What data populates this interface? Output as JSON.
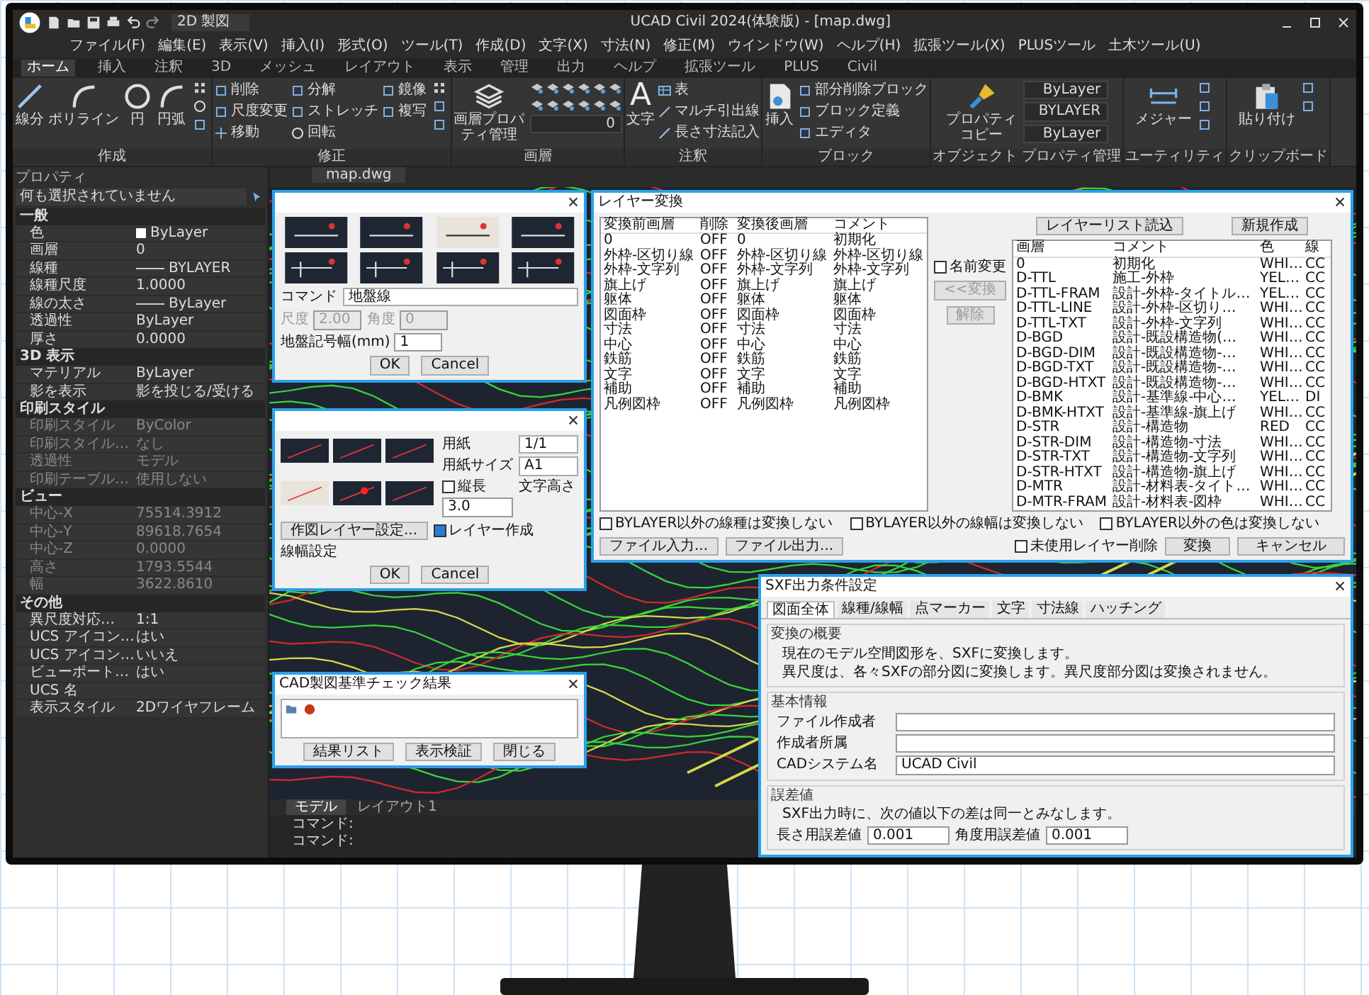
{
  "window": {
    "title": "UCAD Civil 2024(体験版) - [map.dwg]",
    "workspace": "2D 製図"
  },
  "menu": [
    "ファイル(F)",
    "編集(E)",
    "表示(V)",
    "挿入(I)",
    "形式(O)",
    "ツール(T)",
    "作成(D)",
    "文字(X)",
    "寸法(N)",
    "修正(M)",
    "ウインドウ(W)",
    "ヘルプ(H)",
    "拡張ツール(X)",
    "PLUSツール",
    "土木ツール(U)"
  ],
  "ribbon_tabs": [
    {
      "label": "ホーム",
      "selected": true
    },
    {
      "label": "挿入",
      "selected": false
    },
    {
      "label": "注釈",
      "selected": false
    },
    {
      "label": "3D",
      "selected": false
    },
    {
      "label": "メッシュ",
      "selected": false
    },
    {
      "label": "レイアウト",
      "selected": false
    },
    {
      "label": "表示",
      "selected": false
    },
    {
      "label": "管理",
      "selected": false
    },
    {
      "label": "出力",
      "selected": false
    },
    {
      "label": "ヘルプ",
      "selected": false
    },
    {
      "label": "拡張ツール",
      "selected": false
    },
    {
      "label": "PLUS",
      "selected": false
    },
    {
      "label": "Civil",
      "selected": false
    }
  ],
  "ribbon_groups": [
    {
      "title": "作成",
      "large_buttons": [
        {
          "label": "線分",
          "kind": "line"
        },
        {
          "label": "ポリライン",
          "kind": "arc"
        },
        {
          "label": "円",
          "kind": "circle"
        },
        {
          "label": "円弧",
          "kind": "arc"
        }
      ],
      "icon_buttons": [
        {
          "kind": "grid"
        },
        {
          "kind": "circle"
        },
        {
          "kind": "square"
        }
      ]
    },
    {
      "title": "修正",
      "small_buttons": [
        {
          "label": "削除",
          "kind": "square"
        },
        {
          "label": "尺度変更",
          "kind": "square"
        },
        {
          "label": "移動",
          "kind": "move"
        },
        {
          "label": "分解",
          "kind": "square"
        },
        {
          "label": "ストレッチ",
          "kind": "square"
        },
        {
          "label": "回転",
          "kind": "circle"
        },
        {
          "label": "鏡像",
          "kind": "square"
        },
        {
          "label": "複写",
          "kind": "square"
        }
      ],
      "icon_buttons": [
        {
          "kind": "grid"
        },
        {
          "kind": "square"
        },
        {
          "kind": "square"
        }
      ]
    },
    {
      "title": "画層",
      "large_buttons": [
        {
          "label": "画層プロパティ管理",
          "kind": "layers"
        }
      ],
      "icon_buttons": [
        {
          "kind": "layer"
        },
        {
          "kind": "layer"
        },
        {
          "kind": "layer"
        },
        {
          "kind": "layer"
        },
        {
          "kind": "layer"
        },
        {
          "kind": "layer"
        },
        {
          "kind": "layer"
        },
        {
          "kind": "layer"
        },
        {
          "kind": "layer"
        },
        {
          "kind": "layer"
        },
        {
          "kind": "layer"
        },
        {
          "kind": "layer"
        }
      ],
      "dropdowns": [
        {
          "label": "0"
        }
      ]
    },
    {
      "title": "注釈",
      "large_buttons": [
        {
          "label": "文字",
          "kind": "text",
          "glyph": "A"
        }
      ],
      "small_buttons": [
        {
          "label": "表",
          "kind": "table"
        },
        {
          "label": "マルチ引出線",
          "kind": "line"
        },
        {
          "label": "長さ寸法記入",
          "kind": "line"
        }
      ]
    },
    {
      "title": "ブロック",
      "large_buttons": [
        {
          "label": "挿入",
          "kind": "insert"
        }
      ],
      "small_buttons": [
        {
          "label": "部分削除ブロック",
          "kind": "square"
        },
        {
          "label": "ブロック定義",
          "kind": "square"
        },
        {
          "label": "エディタ",
          "kind": "square"
        }
      ]
    },
    {
      "title": "オブジェクト プロパティ管理",
      "large_buttons": [
        {
          "label": "プロパティコピー",
          "kind": "brush"
        }
      ],
      "dropdowns": [
        {
          "label": "ByLayer"
        },
        {
          "label": "BYLAYER"
        },
        {
          "label": "ByLayer"
        }
      ]
    },
    {
      "title": "ユーティリティ",
      "large_buttons": [
        {
          "label": "メジャー",
          "kind": "measure"
        }
      ],
      "icon_buttons": [
        {
          "kind": "square"
        },
        {
          "kind": "square"
        },
        {
          "kind": "square"
        }
      ]
    },
    {
      "title": "クリップボード",
      "large_buttons": [
        {
          "label": "貼り付け",
          "kind": "paste"
        }
      ],
      "icon_buttons": [
        {
          "kind": "square"
        },
        {
          "kind": "square"
        }
      ]
    }
  ],
  "properties": {
    "title": "プロパティ",
    "selection": "何も選択されていません",
    "sections": [
      {
        "title": "一般",
        "rows": [
          {
            "label": "色",
            "value": "ByLayer",
            "kind": "swatch",
            "disabled": false
          },
          {
            "label": "画層",
            "value": "0",
            "kind": "text",
            "disabled": false
          },
          {
            "label": "線種",
            "value": "BYLAYER",
            "kind": "line",
            "disabled": false
          },
          {
            "label": "線種尺度",
            "value": "1.0000",
            "kind": "text",
            "disabled": false
          },
          {
            "label": "線の太さ",
            "value": "ByLayer",
            "kind": "line",
            "disabled": false
          },
          {
            "label": "透過性",
            "value": "ByLayer",
            "kind": "text",
            "disabled": false
          },
          {
            "label": "厚さ",
            "value": "0.0000",
            "kind": "text",
            "disabled": false
          }
        ]
      },
      {
        "title": "3D 表示",
        "rows": [
          {
            "label": "マテリアル",
            "value": "ByLayer",
            "kind": "text",
            "disabled": false
          },
          {
            "label": "影を表示",
            "value": "影を投じる/受ける",
            "kind": "text",
            "disabled": false
          }
        ]
      },
      {
        "title": "印刷スタイル",
        "rows": [
          {
            "label": "印刷スタイル",
            "value": "ByColor",
            "kind": "text",
            "disabled": true
          },
          {
            "label": "印刷スタイル…",
            "value": "なし",
            "kind": "text",
            "disabled": true
          },
          {
            "label": "透過性",
            "value": "モデル",
            "kind": "text",
            "disabled": true
          },
          {
            "label": "印刷テーブル…",
            "value": "使用しない",
            "kind": "text",
            "disabled": true
          }
        ]
      },
      {
        "title": "ビュー",
        "rows": [
          {
            "label": "中心-X",
            "value": "75514.3912",
            "kind": "text",
            "disabled": true
          },
          {
            "label": "中心-Y",
            "value": "89618.7654",
            "kind": "text",
            "disabled": true
          },
          {
            "label": "中心-Z",
            "value": "0.0000",
            "kind": "text",
            "disabled": true
          },
          {
            "label": "高さ",
            "value": "1793.5544",
            "kind": "text",
            "disabled": true
          },
          {
            "label": "幅",
            "value": "3622.8610",
            "kind": "text",
            "disabled": true
          }
        ]
      },
      {
        "title": "その他",
        "rows": [
          {
            "label": "異尺度対応…",
            "value": "1:1",
            "kind": "text",
            "disabled": false
          },
          {
            "label": "UCS アイコン…",
            "value": "はい",
            "kind": "text",
            "disabled": false
          },
          {
            "label": "UCS アイコン…",
            "value": "いいえ",
            "kind": "text",
            "disabled": false
          },
          {
            "label": "ビューポート…",
            "value": "はい",
            "kind": "text",
            "disabled": false
          },
          {
            "label": "UCS 名",
            "kind": "text",
            "disabled": false
          },
          {
            "label": "表示スタイル",
            "value": "2Dワイヤフレーム",
            "kind": "text",
            "disabled": false
          }
        ]
      }
    ]
  },
  "document_tab": "map.dwg",
  "layout_tabs": [
    {
      "label": "モデル",
      "selected": true
    },
    {
      "label": "レイアウト1",
      "selected": false
    }
  ],
  "command_lines": [
    "コマンド:",
    "コマンド:"
  ],
  "pattern_dialog": {
    "command_label": "コマンド",
    "command_value": "地盤線",
    "fields": [
      {
        "label": "尺度",
        "value": "2.00",
        "disabled": true
      },
      {
        "label": "角度",
        "value": "0",
        "disabled": true
      },
      {
        "label": "地盤記号幅(mm)",
        "value": "1",
        "disabled": false
      }
    ],
    "buttons": [
      "OK",
      "Cancel"
    ]
  },
  "sheet_dialog": {
    "fields": [
      {
        "label": "用紙",
        "value": "1/1"
      },
      {
        "label": "用紙サイズ",
        "value": "A1"
      }
    ],
    "portrait": {
      "label": "縦長",
      "checked": false
    },
    "text_height": {
      "label": "文字高さ",
      "value": "3.0"
    },
    "layer_button": "作図レイヤー設定...",
    "create_layer": {
      "label": "レイヤー作成",
      "checked": true
    },
    "line_width_label": "線幅設定",
    "buttons": [
      "OK",
      "Cancel"
    ]
  },
  "layer_dialog": {
    "title": "レイヤー変換",
    "top_buttons": [
      "レイヤーリスト読込",
      "新規作成"
    ],
    "left_columns": [
      "変換前画層",
      "削除",
      "変換後画層",
      "コメント"
    ],
    "left_rows": [
      [
        "0",
        "OFF",
        "0",
        "初期化"
      ],
      [
        "外枠-区切り線",
        "OFF",
        "外枠-区切り線",
        "外枠-区切り線"
      ],
      [
        "外枠-文字列",
        "OFF",
        "外枠-文字列",
        "外枠-文字列"
      ],
      [
        "旗上げ",
        "OFF",
        "旗上げ",
        "旗上げ"
      ],
      [
        "躯体",
        "OFF",
        "躯体",
        "躯体"
      ],
      [
        "図面枠",
        "OFF",
        "図面枠",
        "図面枠"
      ],
      [
        "寸法",
        "OFF",
        "寸法",
        "寸法"
      ],
      [
        "中心",
        "OFF",
        "中心",
        "中心"
      ],
      [
        "鉄筋",
        "OFF",
        "鉄筋",
        "鉄筋"
      ],
      [
        "文字",
        "OFF",
        "文字",
        "文字"
      ],
      [
        "補助",
        "OFF",
        "補助",
        "補助"
      ],
      [
        "凡例図枠",
        "OFF",
        "凡例図枠",
        "凡例図枠"
      ]
    ],
    "rename": {
      "label": "名前変更",
      "checked": false
    },
    "middle_buttons": [
      {
        "label": "<<変換",
        "disabled": true
      },
      {
        "label": "解除",
        "disabled": true
      }
    ],
    "right_columns": [
      "画層",
      "コメント",
      "色",
      "線"
    ],
    "right_rows": [
      [
        "0",
        "初期化",
        "WHI…",
        "CC"
      ],
      [
        "D-TTL",
        "施工-外枠",
        "YEL…",
        "CC"
      ],
      [
        "D-TTL-FRAM",
        "設計-外枠-タイトル…",
        "YEL…",
        "CC"
      ],
      [
        "D-TTL-LINE",
        "設計-外枠-区切り…",
        "WHI…",
        "CC"
      ],
      [
        "D-TTL-TXT",
        "設計-外枠-文字列",
        "WHI…",
        "CC"
      ],
      [
        "D-BGD",
        "設計-既設構造物(…",
        "WHI…",
        "CC"
      ],
      [
        "D-BGD-DIM",
        "設計-既設構造物-…",
        "WHI…",
        "CC"
      ],
      [
        "D-BGD-TXT",
        "設計-既設構造物-…",
        "WHI…",
        "CC"
      ],
      [
        "D-BGD-HTXT",
        "設計-既設構造物-…",
        "WHI…",
        "CC"
      ],
      [
        "D-BMK",
        "設計-基準線-中心…",
        "YEL…",
        "DI"
      ],
      [
        "D-BMK-HTXT",
        "設計-基準線-旗上げ",
        "WHI…",
        "CC"
      ],
      [
        "D-STR",
        "設計-構造物",
        "RED",
        "CC"
      ],
      [
        "D-STR-DIM",
        "設計-構造物-寸法",
        "WHI…",
        "CC"
      ],
      [
        "D-STR-TXT",
        "設計-構造物-文字列",
        "WHI…",
        "CC"
      ],
      [
        "D-STR-HTXT",
        "設計-構造物-旗上げ",
        "WHI…",
        "CC"
      ],
      [
        "D-MTR",
        "設計-材料表-タイト…",
        "WHI…",
        "CC"
      ],
      [
        "D-MTR-FRAM",
        "設計-材料表-図枠",
        "WHI…",
        "CC"
      ]
    ],
    "options": [
      {
        "label": "BYLAYER以外の線種は変換しない",
        "checked": false
      },
      {
        "label": "BYLAYER以外の線幅は変換しない",
        "checked": false
      },
      {
        "label": "BYLAYER以外の色は変換しない",
        "checked": false
      }
    ],
    "file_buttons": [
      "ファイル入力...",
      "ファイル出力..."
    ],
    "purge": {
      "label": "未使用レイヤー削除",
      "checked": false
    },
    "action_buttons": [
      "変換",
      "キャンセル"
    ]
  },
  "check_dialog": {
    "title": "CAD製図基準チェック結果",
    "buttons": [
      "結果リスト",
      "表示検証",
      "閉じる"
    ]
  },
  "sxf_dialog": {
    "title": "SXF出力条件設定",
    "tabs": [
      {
        "label": "図面全体",
        "selected": true
      },
      {
        "label": "線種/線幅",
        "selected": false
      },
      {
        "label": "点マーカー",
        "selected": false
      },
      {
        "label": "文字",
        "selected": false
      },
      {
        "label": "寸法線",
        "selected": false
      },
      {
        "label": "ハッチング",
        "selected": false
      }
    ],
    "summary_title": "変換の概要",
    "summary": [
      "現在のモデル空間図形を、SXFに変換します。",
      "異尺度は、各々SXFの部分図に変換します。異尺度部分図は変換されません。"
    ],
    "info_title": "基本情報",
    "info_fields": [
      {
        "label": "ファイル作成者"
      },
      {
        "label": "作成者所属"
      },
      {
        "label": "CADシステム名",
        "value": "UCAD Civil"
      }
    ],
    "tolerance_title": "誤差値",
    "tolerance_note": "SXF出力時に、次の値以下の差は同一とみなします。",
    "tolerance_fields": [
      {
        "label": "長さ用誤差値",
        "value": "0.001"
      },
      {
        "label": "角度用誤差値",
        "value": "0.001"
      }
    ]
  }
}
